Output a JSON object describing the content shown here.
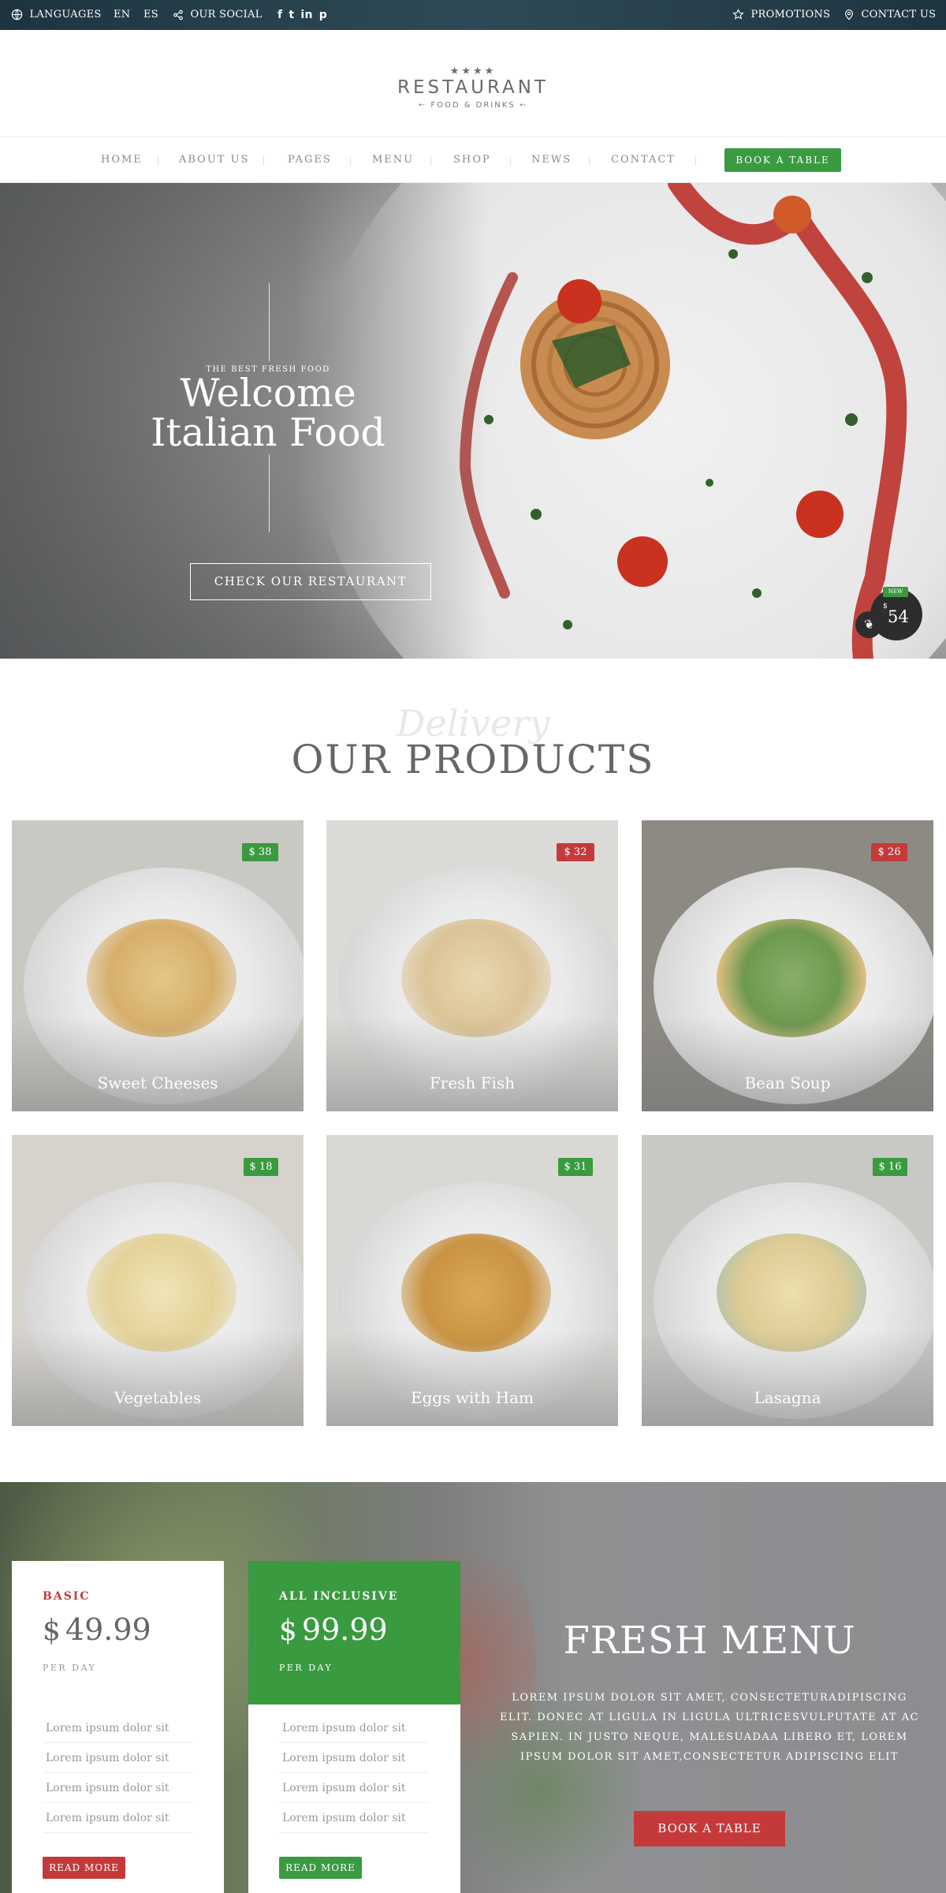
{
  "topbar": {
    "languages_label": "LANGUAGES",
    "lang_en": "EN",
    "lang_es": "ES",
    "social_label": "OUR SOCIAL",
    "social_icons": [
      "facebook-icon",
      "twitter-icon",
      "linkedin-icon",
      "pinterest-icon"
    ],
    "promotions_label": "PROMOTIONS",
    "contact_label": "CONTACT US"
  },
  "logo": {
    "stars": "★★★★",
    "title": "RESTAURANT",
    "subtitle": "FOOD & DRINKS"
  },
  "nav": {
    "items": [
      "HOME",
      "ABOUT US",
      "PAGES",
      "MENU",
      "SHOP",
      "NEWS",
      "CONTACT"
    ],
    "book_label": "BOOK A TABLE"
  },
  "hero": {
    "eyebrow": "THE BEST FRESH FOOD",
    "title_line1": "Welcome",
    "title_line2": "Italian Food",
    "button_label": "CHECK OUR RESTAURANT",
    "badge_new": "NEW",
    "badge_currency": "$",
    "badge_price": "54"
  },
  "products": {
    "script_text": "Delivery",
    "title": "OUR PRODUCTS",
    "items": [
      {
        "name": "Sweet Cheeses",
        "price": "$ 38",
        "tag": "green"
      },
      {
        "name": "Fresh Fish",
        "price": "$ 32",
        "tag": "red"
      },
      {
        "name": "Bean Soup",
        "price": "$ 26",
        "tag": "red"
      },
      {
        "name": "Vegetables",
        "price": "$ 18",
        "tag": "green"
      },
      {
        "name": "Eggs with Ham",
        "price": "$ 31",
        "tag": "green"
      },
      {
        "name": "Lasagna",
        "price": "$ 16",
        "tag": "green"
      }
    ]
  },
  "pricing": {
    "cards": [
      {
        "name": "BASIC",
        "currency": "$",
        "amount": "49.99",
        "period": "PER DAY",
        "features": [
          "Lorem ipsum dolor sit",
          "Lorem ipsum dolor sit",
          "Lorem ipsum dolor sit",
          "Lorem ipsum dolor sit"
        ],
        "button": "READ MORE"
      },
      {
        "name": "ALL INCLUSIVE",
        "currency": "$",
        "amount": "99.99",
        "period": "PER DAY",
        "features": [
          "Lorem ipsum dolor sit",
          "Lorem ipsum dolor sit",
          "Lorem ipsum dolor sit",
          "Lorem ipsum dolor sit"
        ],
        "button": "READ MORE"
      }
    ]
  },
  "fresh_menu": {
    "title": "FRESH MENU",
    "text": "LOREM IPSUM DOLOR SIT AMET, CONSECTETURADIPISCING ELIT. DONEC AT LIGULA IN LIGULA ULTRICESVULPUTATE AT AC SAPIEN. IN JUSTO NEQUE, MALESUADAA LIBERO ET, LOREM IPSUM DOLOR SIT AMET,CONSECTETUR ADIPISCING ELIT",
    "button": "BOOK A TABLE"
  },
  "colors": {
    "green": "#3a9a40",
    "red": "#c43a3a",
    "topbar": "#1d3440"
  }
}
